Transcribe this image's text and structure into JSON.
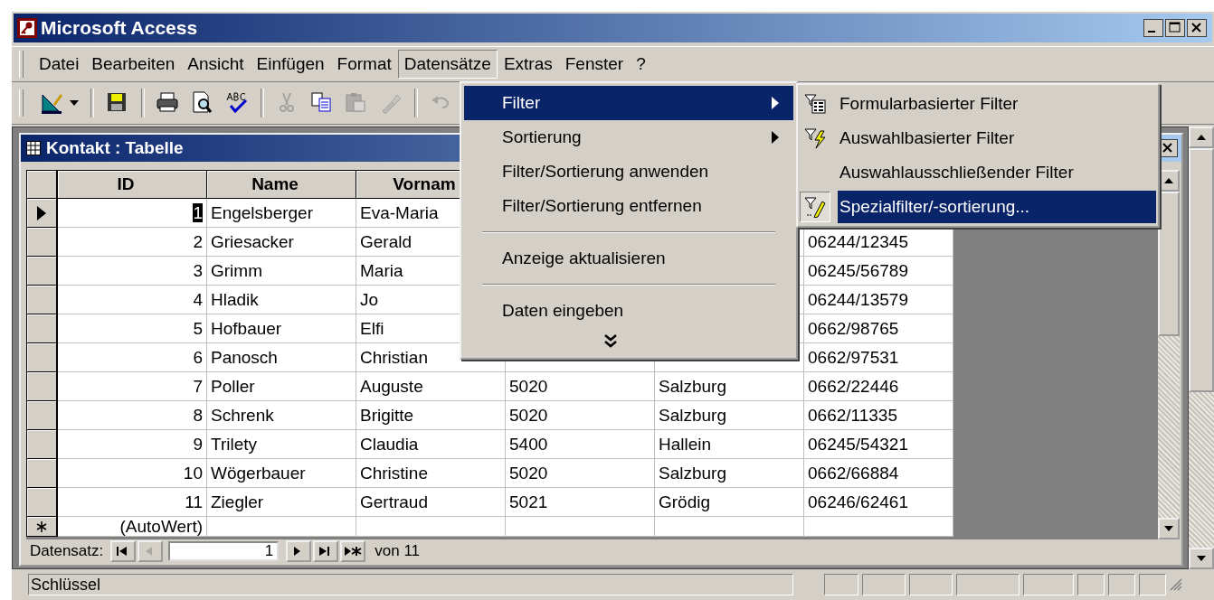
{
  "window": {
    "title": "Microsoft Access"
  },
  "menu_bar": [
    {
      "label": "Datei",
      "selected": false
    },
    {
      "label": "Bearbeiten",
      "selected": false
    },
    {
      "label": "Ansicht",
      "selected": false
    },
    {
      "label": "Einfügen",
      "selected": false
    },
    {
      "label": "Format",
      "selected": false
    },
    {
      "label": "Datensätze",
      "selected": true
    },
    {
      "label": "Extras",
      "selected": false
    },
    {
      "label": "Fenster",
      "selected": false
    },
    {
      "label": "?",
      "selected": false
    }
  ],
  "toolbar": {
    "groups": [
      [
        {
          "kind": "design",
          "disabled": false,
          "dropdown": true
        }
      ],
      [
        {
          "kind": "save",
          "disabled": false,
          "dropdown": false
        }
      ],
      [
        {
          "kind": "print",
          "disabled": false,
          "dropdown": false
        },
        {
          "kind": "preview",
          "disabled": false,
          "dropdown": false
        },
        {
          "kind": "spelling",
          "disabled": false,
          "dropdown": false
        }
      ],
      [
        {
          "kind": "cut",
          "disabled": true,
          "dropdown": false
        },
        {
          "kind": "copy",
          "disabled": false,
          "dropdown": false
        },
        {
          "kind": "paste",
          "disabled": true,
          "dropdown": false
        },
        {
          "kind": "painter",
          "disabled": true,
          "dropdown": false
        }
      ],
      [
        {
          "kind": "undo",
          "disabled": true,
          "dropdown": false
        }
      ]
    ]
  },
  "table_window": {
    "title": "Kontakt : Tabelle",
    "columns": [
      "ID",
      "Name",
      "Vornam"
    ],
    "rows": [
      {
        "cells": [
          "1",
          "Engelsberger",
          "Eva-Maria",
          null,
          null,
          null
        ],
        "current": true
      },
      {
        "cells": [
          "2",
          "Griesacker",
          "Gerald",
          null,
          null,
          "06244/12345"
        ],
        "current": false
      },
      {
        "cells": [
          "3",
          "Grimm",
          "Maria",
          null,
          null,
          "06245/56789"
        ],
        "current": false
      },
      {
        "cells": [
          "4",
          "Hladik",
          "Jo",
          null,
          null,
          "06244/13579"
        ],
        "current": false
      },
      {
        "cells": [
          "5",
          "Hofbauer",
          "Elfi",
          null,
          null,
          "0662/98765"
        ],
        "current": false
      },
      {
        "cells": [
          "6",
          "Panosch",
          "Christian",
          null,
          null,
          "0662/97531"
        ],
        "current": false
      },
      {
        "cells": [
          "7",
          "Poller",
          "Auguste",
          "5020",
          "Salzburg",
          "0662/22446"
        ],
        "current": false
      },
      {
        "cells": [
          "8",
          "Schrenk",
          "Brigitte",
          "5020",
          "Salzburg",
          "0662/11335"
        ],
        "current": false
      },
      {
        "cells": [
          "9",
          "Trilety",
          "Claudia",
          "5400",
          "Hallein",
          "06245/54321"
        ],
        "current": false
      },
      {
        "cells": [
          "10",
          "Wögerbauer",
          "Christine",
          "5020",
          "Salzburg",
          "0662/66884"
        ],
        "current": false
      },
      {
        "cells": [
          "11",
          "Ziegler",
          "Gertraud",
          "5021",
          "Grödig",
          "06246/62461"
        ],
        "current": false
      }
    ],
    "new_row": {
      "id": "(AutoWert)"
    },
    "record_nav": {
      "label": "Datensatz:",
      "buttons_before": [
        {
          "kind": "first",
          "disabled": false
        },
        {
          "kind": "previous",
          "disabled": true
        }
      ],
      "current": "1",
      "buttons_after": [
        {
          "kind": "next",
          "disabled": false
        },
        {
          "kind": "last",
          "disabled": false
        },
        {
          "kind": "new",
          "disabled": false
        }
      ],
      "total": "von 11"
    }
  },
  "dropdown_menu": {
    "items": [
      {
        "kind": "item",
        "label": "Filter",
        "selected": true,
        "submenu": true
      },
      {
        "kind": "item",
        "label": "Sortierung",
        "selected": false,
        "submenu": true
      },
      {
        "kind": "item",
        "label": "Filter/Sortierung anwenden",
        "selected": false,
        "submenu": false
      },
      {
        "kind": "item",
        "label": "Filter/Sortierung entfernen",
        "selected": false,
        "submenu": false
      },
      {
        "kind": "separator"
      },
      {
        "kind": "item",
        "label": "Anzeige aktualisieren",
        "selected": false,
        "submenu": false
      },
      {
        "kind": "separator"
      },
      {
        "kind": "item",
        "label": "Daten eingeben",
        "selected": false,
        "submenu": false
      },
      {
        "kind": "more"
      }
    ]
  },
  "submenu": {
    "items": [
      {
        "label": "Formularbasierter Filter",
        "kind": "form",
        "selected": false
      },
      {
        "label": "Auswahlbasierter Filter",
        "kind": "selection",
        "selected": false
      },
      {
        "label": "Auswahlausschließender Filter",
        "kind": "plain",
        "selected": false
      },
      {
        "label": "Spezialfilter/-sortierung...",
        "kind": "special",
        "selected": true
      }
    ]
  },
  "status_bar": {
    "text": "Schlüssel"
  }
}
